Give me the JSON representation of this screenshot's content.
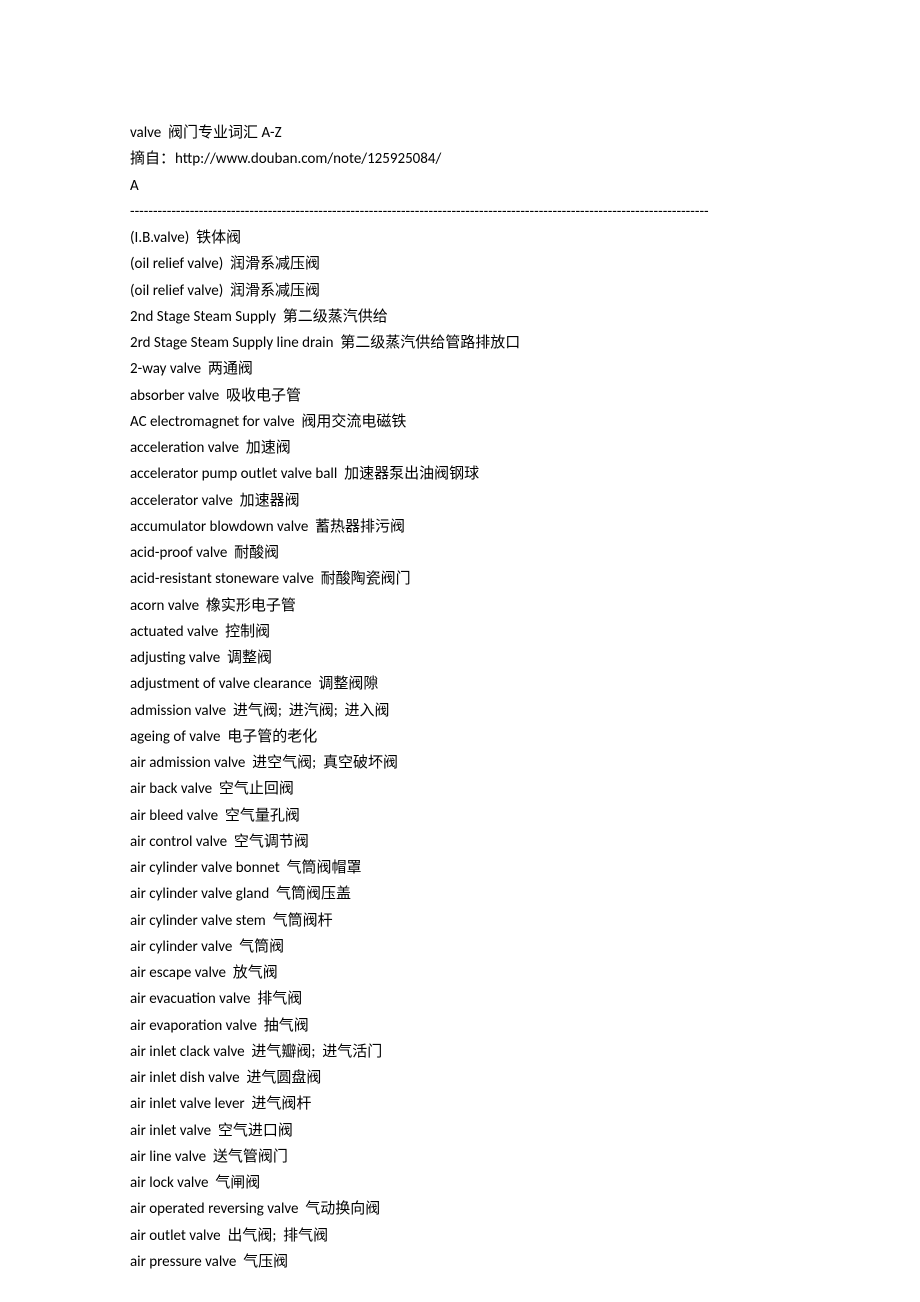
{
  "title": "valve  阀门专业词汇 A-Z",
  "source_label": "摘自：http://www.douban.com/note/125925084/",
  "section_letter": "A",
  "divider": "------------------------------------------------------------------------------------------------------------------------------",
  "entries": [
    "(I.B.valve)  铁体阀",
    "(oil relief valve)  润滑系减压阀",
    "(oil relief valve)  润滑系减压阀",
    "2nd Stage Steam Supply  第二级蒸汽供给",
    "2rd Stage Steam Supply line drain  第二级蒸汽供给管路排放口",
    "2-way valve  两通阀",
    "absorber valve  吸收电子管",
    "AC electromagnet for valve  阀用交流电磁铁",
    "acceleration valve  加速阀",
    "accelerator pump outlet valve ball  加速器泵出油阀钢球",
    "accelerator valve  加速器阀",
    "accumulator blowdown valve  蓄热器排污阀",
    "acid-proof valve  耐酸阀",
    "acid-resistant stoneware valve  耐酸陶瓷阀门",
    "acorn valve  橡实形电子管",
    "actuated valve  控制阀",
    "adjusting valve  调整阀",
    "adjustment of valve clearance  调整阀隙",
    "admission valve  进气阀;  进汽阀;  进入阀",
    "ageing of valve  电子管的老化",
    "air admission valve  进空气阀;  真空破坏阀",
    "air back valve  空气止回阀",
    "air bleed valve  空气量孔阀",
    "air control valve  空气调节阀",
    "air cylinder valve bonnet  气筒阀帽罩",
    "air cylinder valve gland  气筒阀压盖",
    "air cylinder valve stem  气筒阀杆",
    "air cylinder valve  气筒阀",
    "air escape valve  放气阀",
    "air evacuation valve  排气阀",
    "air evaporation valve  抽气阀",
    "air inlet clack valve  进气瓣阀;  进气活门",
    "air inlet dish valve  进气圆盘阀",
    "air inlet valve lever  进气阀杆",
    "air inlet valve  空气进口阀",
    "air line valve  送气管阀门",
    "air lock valve  气闸阀",
    "air operated reversing valve  气动换向阀",
    "air outlet valve  出气阀;  排气阀",
    "air pressure valve  气压阀"
  ]
}
